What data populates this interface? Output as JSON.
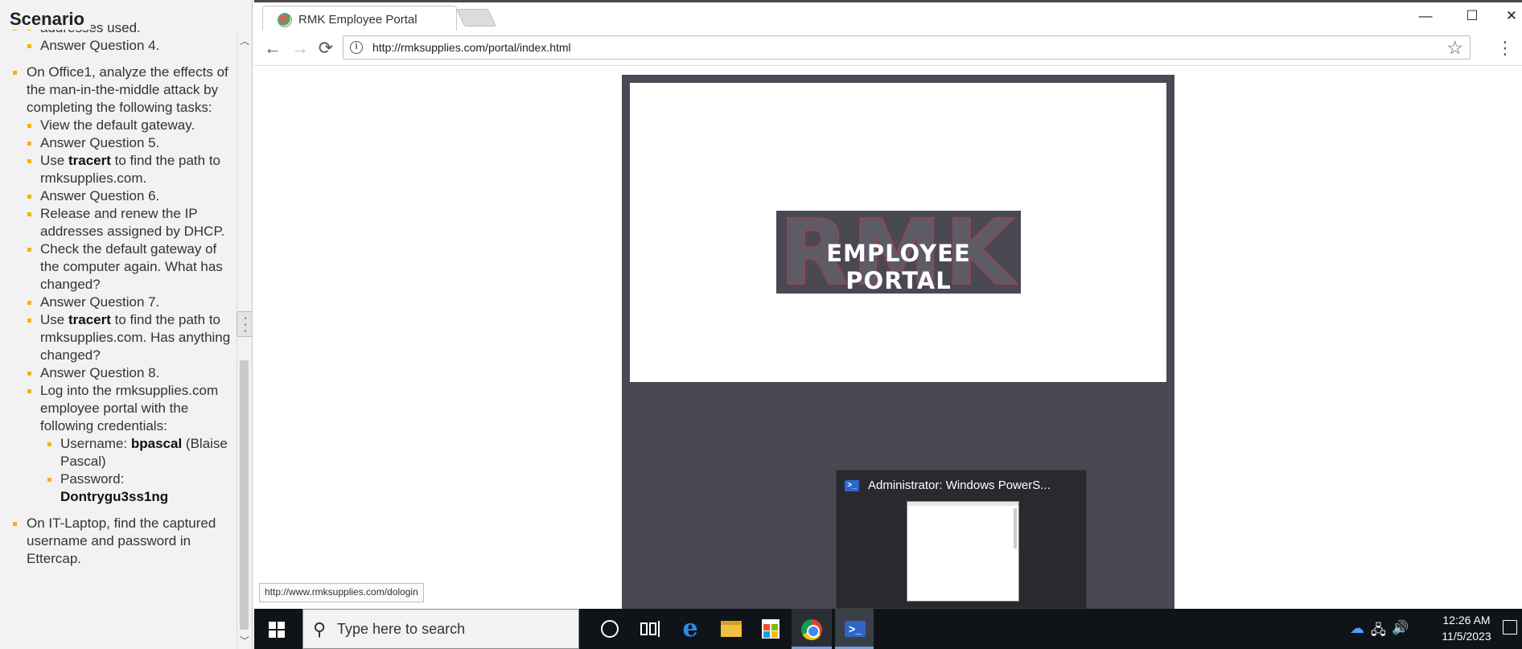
{
  "scenario": {
    "title": "Scenario",
    "items": [
      {
        "sub": [
          "addresses used.",
          "Answer Question 4."
        ]
      },
      {
        "text": "On Office1, analyze the effects of the man-in-the-middle attack by completing the following tasks:",
        "sub": [
          "View the default gateway.",
          "Answer Question 5.",
          {
            "pre": "Use ",
            "bold": "tracert",
            "post": " to find the path to rmksupplies.com."
          },
          "Answer Question 6.",
          "Release and renew the IP addresses assigned by DHCP.",
          "Check the default gateway of the computer again. What has changed?",
          "Answer Question 7.",
          {
            "pre": "Use ",
            "bold": "tracert",
            "post": " to find the path to rmksupplies.com. Has anything changed?"
          },
          "Answer Question 8.",
          "Log into the rmksupplies.com employee portal with the following credentials:"
        ],
        "credentials": [
          {
            "label": "Username: ",
            "value": "bpascal",
            "note": " (Blaise Pascal)"
          },
          {
            "label": "Password: ",
            "value": "Dontrygu3ss1ng",
            "note": ""
          }
        ]
      },
      {
        "text": "On IT-Laptop, find the captured username and password in Ettercap."
      }
    ]
  },
  "browser": {
    "tab_title": "RMK Employee Portal",
    "url": "http://rmksupplies.com/portal/index.html",
    "status_url": "http://www.rmksupplies.com/dologin",
    "window_controls": {
      "minimize": "—",
      "maximize": "☐",
      "close": "✕"
    },
    "nav": {
      "back": "←",
      "forward": "→",
      "reload": "⟳",
      "info": "i",
      "star": "☆",
      "menu": "⋮"
    }
  },
  "portal": {
    "logo_big": "RMK",
    "logo_small": "EMPLOYEE PORTAL"
  },
  "thumbnail": {
    "title": "Administrator: Windows PowerS...",
    "icon": ">_"
  },
  "taskbar": {
    "search_placeholder": "Type here to search",
    "ps_icon": ">_",
    "clock_time": "12:26 AM",
    "clock_date": "11/5/2023",
    "tray_icons": [
      "cloud-icon",
      "network-icon",
      "volume-icon"
    ]
  },
  "colors": {
    "bullet": "#f5b400",
    "portal_bg": "#4a4853",
    "taskbar": "#101418"
  }
}
